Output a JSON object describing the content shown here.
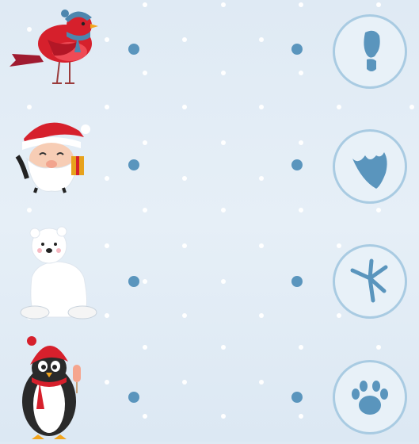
{
  "puzzle": {
    "rows": [
      {
        "animal": "bird",
        "track": "boot-print-icon"
      },
      {
        "animal": "santa",
        "track": "webbed-foot-icon"
      },
      {
        "animal": "polar-bear",
        "track": "bird-track-icon"
      },
      {
        "animal": "penguin",
        "track": "paw-print-icon"
      }
    ]
  },
  "colors": {
    "background": "#e3edf6",
    "dot": "#5a95bd",
    "track": "#5a95bd",
    "circle_border": "#a9cbe2",
    "red": "#d6202c"
  }
}
